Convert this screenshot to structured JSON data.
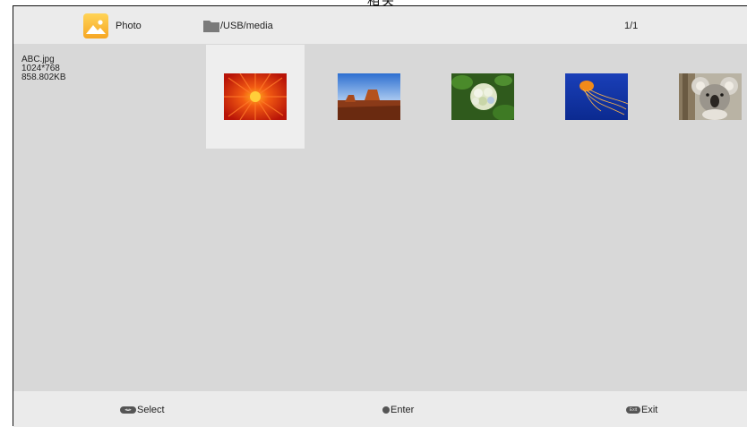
{
  "top_caption": "相关",
  "header": {
    "app_title": "Photo",
    "path": "/USB/media",
    "page_indicator": "1/1"
  },
  "file_info": {
    "name": "ABC.jpg",
    "resolution": "1024*768",
    "size": "858.802KB"
  },
  "thumbnails": [
    {
      "subject": "red-flower",
      "selected": true
    },
    {
      "subject": "desert-butte",
      "selected": false
    },
    {
      "subject": "white-hydrangea",
      "selected": false
    },
    {
      "subject": "jellyfish",
      "selected": false
    },
    {
      "subject": "koala",
      "selected": false
    }
  ],
  "footer": {
    "select_label": "Select",
    "enter_label": "Enter",
    "exit_label": "Exit",
    "exit_key_text": "Exit"
  },
  "colors": {
    "background": "#d8d8d8",
    "bar": "#ebebeb",
    "selected": "#eeeeee",
    "app_icon": "#f6a623"
  }
}
